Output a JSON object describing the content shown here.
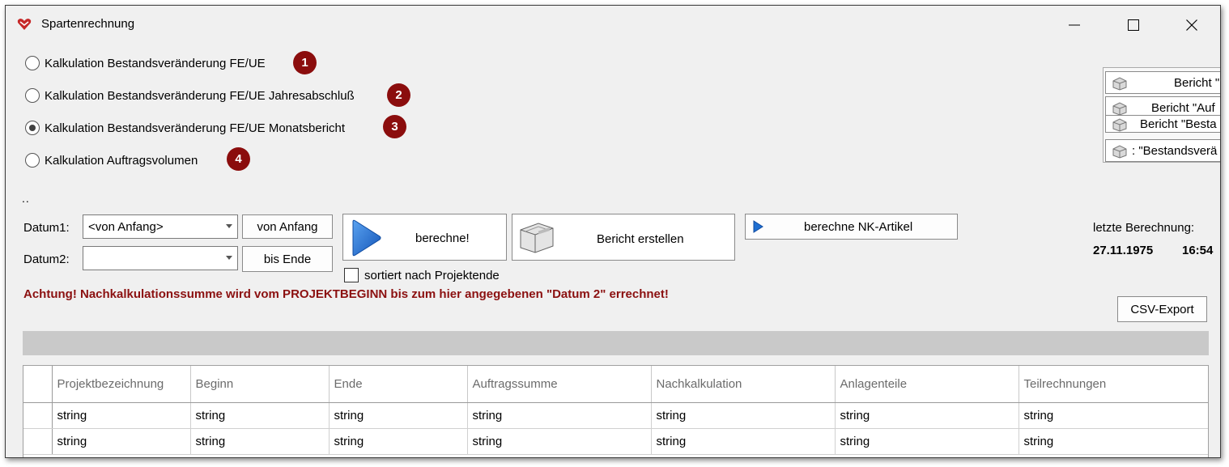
{
  "window": {
    "title": "Spartenrechnung",
    "minimize_glyph": "—",
    "maximize_glyph": "☐",
    "close_glyph": "✕"
  },
  "options": [
    {
      "label": "Kalkulation Bestandsveränderung FE/UE",
      "badge": "1",
      "checked": false
    },
    {
      "label": "Kalkulation Bestandsveränderung FE/UE Jahresabschluß",
      "badge": "2",
      "checked": false
    },
    {
      "label": "Kalkulation Bestandsveränderung FE/UE Monatsbericht",
      "badge": "3",
      "checked": true
    },
    {
      "label": "Kalkulation Auftragsvolumen",
      "badge": "4",
      "checked": false
    }
  ],
  "report_buttons": [
    {
      "label": "Bericht \""
    },
    {
      "label": "Bericht \"Auf"
    },
    {
      "label": "Bericht \"Besta"
    },
    {
      "label": ": \"Bestandsverä"
    }
  ],
  "dots": "..",
  "controls": {
    "datum1_label": "Datum1:",
    "datum1_value": "<von Anfang>",
    "datum2_label": "Datum2:",
    "datum2_value": "",
    "von_anfang": "von Anfang",
    "bis_ende": "bis Ende",
    "berechne": "berechne!",
    "bericht_erstellen": "Bericht erstellen",
    "berechne_nk": "berechne NK-Artikel",
    "sortiert": "sortiert nach Projektende",
    "letzte_label": "letzte Berechnung:",
    "letzte_date": "27.11.1975",
    "letzte_time": "16:54",
    "csv_export": "CSV-Export"
  },
  "warning": "Achtung! Nachkalkulationssumme wird vom PROJEKTBEGINN bis zum hier angegebenen \"Datum 2\" errechnet!",
  "table": {
    "columns": [
      "Projektbezeichnung",
      "Beginn",
      "Ende",
      "Auftragssumme",
      "Nachkalkulation",
      "Anlagenteile",
      "Teilrechnungen"
    ],
    "rows": [
      [
        "string",
        "string",
        "string",
        "string",
        "string",
        "string",
        "string"
      ],
      [
        "string",
        "string",
        "string",
        "string",
        "string",
        "string",
        "string"
      ]
    ]
  },
  "colors": {
    "badge": "#8b0d0d",
    "warning": "#8b1010",
    "play_icon": "#1f6fd1"
  }
}
